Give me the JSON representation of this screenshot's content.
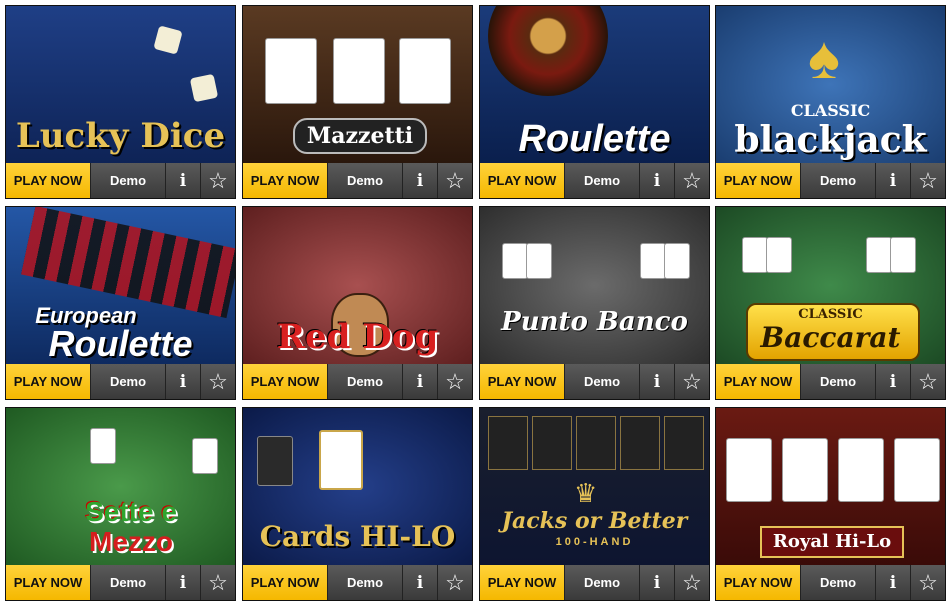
{
  "buttons": {
    "play": "PLAY NOW",
    "demo": "Demo",
    "info": "i",
    "favorite": "☆"
  },
  "games": [
    {
      "title": "Lucky Dice"
    },
    {
      "title": "Mazzetti"
    },
    {
      "title": "Roulette"
    },
    {
      "title_line1": "CLASSIC",
      "title_line2": "blackjack"
    },
    {
      "title_line1": "European",
      "title_line2": "Roulette"
    },
    {
      "title": "Red Dog"
    },
    {
      "title": "Punto Banco"
    },
    {
      "title_line1": "CLASSIC",
      "title_line2": "Baccarat"
    },
    {
      "title_line1": "Sette e",
      "title_line2": "Mezzo"
    },
    {
      "title": "Cards HI-LO"
    },
    {
      "title_line1": "Jacks or Better",
      "title_line2": "100-HAND"
    },
    {
      "title": "Royal Hi-Lo"
    }
  ],
  "colors": {
    "play": "#f5b800",
    "bar": "#3a3a3a"
  }
}
